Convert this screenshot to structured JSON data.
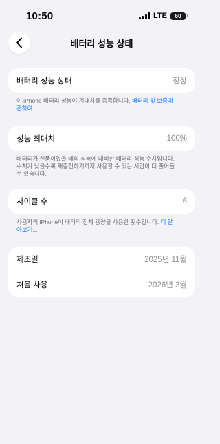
{
  "status_bar": {
    "time": "10:50",
    "network": "LTE",
    "battery": "60"
  },
  "header": {
    "title": "배터리 성능 상태",
    "back_icon": "chevron-left-icon"
  },
  "health": {
    "label": "배터리 성능 상태",
    "value": "정상",
    "footnote": "이 iPhone 배터리 성능이 기대치를 충족합니다. ",
    "footnote_link": "배터리 및 보증에 관하여..."
  },
  "max_capacity": {
    "label": "성능 최대치",
    "value": "100%",
    "footnote": "배터리가 신품이었을 때의 성능에 대비한 배터리 성능 수치입니다. 수치가 낮을수록 재충전하기까지 사용할 수 있는 시간이 더 줄어들 수 있습니다."
  },
  "cycle_count": {
    "label": "사이클 수",
    "value": "6",
    "footnote": "사용자의 iPhone이 배터리 전체 용량을 사용한 횟수입니다. ",
    "footnote_link": "더 알아보기..."
  },
  "dates": {
    "manufacture_label": "제조일",
    "manufacture_value": "2025년 11월",
    "first_use_label": "처음 사용",
    "first_use_value": "2026년 3월"
  }
}
